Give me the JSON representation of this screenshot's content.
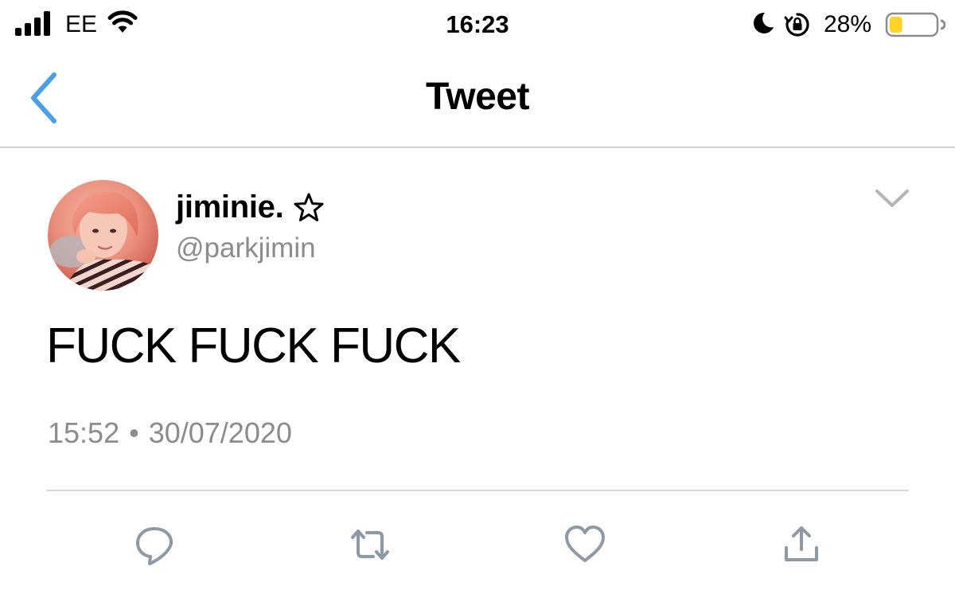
{
  "status_bar": {
    "carrier": "EE",
    "time": "16:23",
    "battery_percent": "28%",
    "battery_level": 0.28,
    "icons": [
      "signal-icon",
      "wifi-icon",
      "moon-icon",
      "rotation-lock-icon",
      "battery-icon"
    ]
  },
  "nav": {
    "title": "Tweet",
    "back_icon": "chevron-left-icon"
  },
  "tweet": {
    "display_name": "jiminie.",
    "name_badge_icon": "star-outline-icon",
    "handle": "@parkjimin",
    "text": "FUCK FUCK FUCK",
    "time": "15:52",
    "separator": "•",
    "date": "30/07/2020",
    "menu_icon": "chevron-down-icon",
    "actions": [
      {
        "name": "reply",
        "icon": "reply-icon"
      },
      {
        "name": "retweet",
        "icon": "retweet-icon"
      },
      {
        "name": "like",
        "icon": "heart-icon"
      },
      {
        "name": "share",
        "icon": "share-icon"
      }
    ]
  },
  "colors": {
    "accent": "#4a9fe8",
    "secondary_text": "#8b8b90",
    "icon_gray": "#8d9aa6",
    "divider": "#d8d8dc",
    "battery_fill": "#ffd426"
  }
}
